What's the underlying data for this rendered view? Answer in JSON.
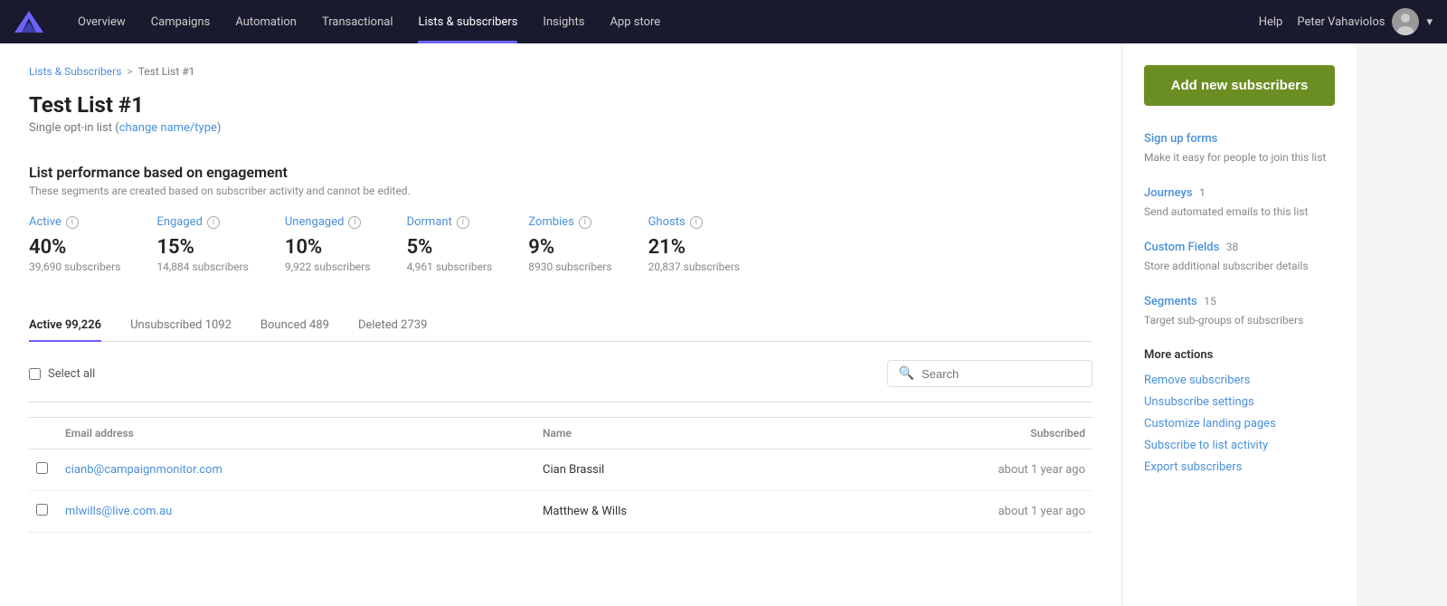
{
  "nav": {
    "items": [
      {
        "label": "Overview",
        "active": false
      },
      {
        "label": "Campaigns",
        "active": false
      },
      {
        "label": "Automation",
        "active": false
      },
      {
        "label": "Transactional",
        "active": false
      },
      {
        "label": "Lists & subscribers",
        "active": true
      },
      {
        "label": "Insights",
        "active": false
      },
      {
        "label": "App store",
        "active": false
      }
    ],
    "help": "Help",
    "user": "Peter Vahaviolos"
  },
  "breadcrumb": {
    "parent": "Lists & Subscribers",
    "separator": ">",
    "current": "Test List #1"
  },
  "page": {
    "title": "Test List #1",
    "subtitle_prefix": "Single opt-in list",
    "subtitle_link": "change name/type"
  },
  "engagement": {
    "section_title": "List performance based on engagement",
    "section_desc": "These segments are created based on subscriber activity and cannot be edited.",
    "segments": [
      {
        "label": "Active",
        "pct": "40%",
        "count": "39,690 subscribers"
      },
      {
        "label": "Engaged",
        "pct": "15%",
        "count": "14,884 subscribers"
      },
      {
        "label": "Unengaged",
        "pct": "10%",
        "count": "9,922 subscribers"
      },
      {
        "label": "Dormant",
        "pct": "5%",
        "count": "4,961 subscribers"
      },
      {
        "label": "Zombies",
        "pct": "9%",
        "count": "8930 subscribers"
      },
      {
        "label": "Ghosts",
        "pct": "21%",
        "count": "20,837 subscribers"
      }
    ]
  },
  "tabs": [
    {
      "label": "Active",
      "count": "99,226",
      "active": true
    },
    {
      "label": "Unsubscribed",
      "count": "1092",
      "active": false
    },
    {
      "label": "Bounced",
      "count": "489",
      "active": false
    },
    {
      "label": "Deleted",
      "count": "2739",
      "active": false
    }
  ],
  "controls": {
    "select_all": "Select all",
    "search_placeholder": "Search"
  },
  "table": {
    "columns": [
      "",
      "Email address",
      "Name",
      "Subscribed"
    ],
    "rows": [
      {
        "email": "cianb@campaignmonitor.com",
        "name": "Cian Brassil",
        "subscribed": "about 1 year ago"
      },
      {
        "email": "mlwills@live.com.au",
        "name": "Matthew & Wills",
        "subscribed": "about 1 year ago"
      }
    ]
  },
  "sidebar": {
    "add_btn": "Add new subscribers",
    "links": [
      {
        "label": "Sign up forms",
        "desc": "Make it easy for people to join this list",
        "badge": ""
      },
      {
        "label": "Journeys",
        "badge": "1",
        "desc": "Send automated emails to this list"
      },
      {
        "label": "Custom Fields",
        "badge": "38",
        "desc": "Store additional subscriber details"
      },
      {
        "label": "Segments",
        "badge": "15",
        "desc": "Target sub-groups of subscribers"
      }
    ],
    "more_actions_title": "More actions",
    "actions": [
      "Remove subscribers",
      "Unsubscribe settings",
      "Customize landing pages",
      "Subscribe to list activity",
      "Export subscribers"
    ]
  }
}
